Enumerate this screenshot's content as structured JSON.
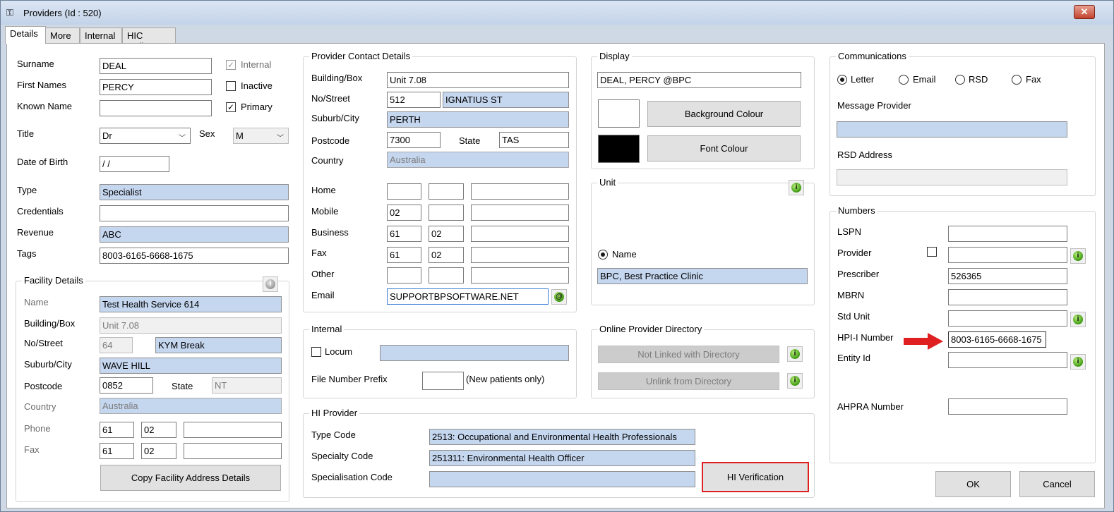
{
  "window": {
    "title": "Providers (Id : 520)",
    "close_glyph": "✕",
    "icon": "key-icon"
  },
  "tabs": [
    "Details",
    "More",
    "Internal",
    "HIC Online"
  ],
  "colors": {
    "field_blue": "#c5d6ef",
    "highlight_red": "#e02020",
    "accent_green": "#3f9a12"
  },
  "personal": {
    "surname_label": "Surname",
    "surname": "DEAL",
    "first_names_label": "First Names",
    "first_names": "PERCY",
    "known_name_label": "Known Name",
    "known_name": "",
    "title_label": "Title",
    "title": "Dr",
    "sex_label": "Sex",
    "sex": "M",
    "dob_label": "Date of Birth",
    "dob": " / /",
    "type_label": "Type",
    "type": "Specialist",
    "credentials_label": "Credentials",
    "credentials": "",
    "revenue_label": "Revenue",
    "revenue": "ABC",
    "tags_label": "Tags",
    "tags": "8003-6165-6668-1675",
    "internal_label": "Internal",
    "inactive_label": "Inactive",
    "primary_label": "Primary",
    "internal_checked": true,
    "inactive_checked": false,
    "primary_checked": true,
    "check_glyph": "✓"
  },
  "facility": {
    "group_title": "Facility Details",
    "name_label": "Name",
    "name": "Test Health Service 614",
    "building_label": "Building/Box",
    "building": "Unit 7.08",
    "street_label": "No/Street",
    "street_no": "64",
    "street_name": "KYM Break",
    "suburb_label": "Suburb/City",
    "suburb": "WAVE HILL",
    "postcode_label": "Postcode",
    "postcode": "0852",
    "state_label": "State",
    "state": "NT",
    "country_label": "Country",
    "country": "Australia",
    "phone_label": "Phone",
    "phone": [
      "61",
      "02",
      ""
    ],
    "fax_label": "Fax",
    "fax": [
      "61",
      "02",
      ""
    ],
    "copy_button": "Copy Facility Address Details"
  },
  "contact": {
    "group_title": "Provider Contact Details",
    "building_label": "Building/Box",
    "building": "Unit 7.08",
    "street_label": "No/Street",
    "street_no": "512",
    "street_name": "IGNATIUS ST",
    "suburb_label": "Suburb/City",
    "suburb": "PERTH",
    "postcode_label": "Postcode",
    "postcode": "7300",
    "state_label": "State",
    "state": "TAS",
    "country_label": "Country",
    "country": "Australia",
    "home_label": "Home",
    "home": [
      "",
      "",
      ""
    ],
    "mobile_label": "Mobile",
    "mobile": [
      "02",
      "",
      ""
    ],
    "business_label": "Business",
    "business": [
      "61",
      "02",
      ""
    ],
    "fax_label": "Fax",
    "fax": [
      "61",
      "02",
      ""
    ],
    "other_label": "Other",
    "other": [
      "",
      "",
      ""
    ],
    "email_label": "Email",
    "email": "SUPPORTBPSOFTWARE.NET",
    "email_glyph": "@"
  },
  "internal": {
    "group_title": "Internal",
    "locum_label": "Locum",
    "locum_value": "",
    "file_prefix_label": "File Number Prefix",
    "file_prefix": "",
    "file_prefix_note": "(New patients only)"
  },
  "hi_provider": {
    "group_title": "HI Provider",
    "type_code_label": "Type Code",
    "type_code": "2513: Occupational and Environmental Health Professionals",
    "specialty_code_label": "Specialty Code",
    "specialty_code": "251311: Environmental Health Officer",
    "specialisation_code_label": "Specialisation Code",
    "specialisation_code": "",
    "verify_button": "HI Verification"
  },
  "display": {
    "group_title": "Display",
    "display_name": "DEAL, PERCY @BPC",
    "background_button": "Background Colour",
    "font_button": "Font Colour",
    "background_color": "#ffffff",
    "font_color": "#000000"
  },
  "unit": {
    "group_title": "Unit",
    "name_radio": "Name",
    "unit_name": "BPC, Best Practice Clinic",
    "info_glyph": "i"
  },
  "directory": {
    "group_title": "Online Provider Directory",
    "link_button": "Not Linked with Directory",
    "unlink_button": "Unlink from Directory"
  },
  "communications": {
    "group_title": "Communications",
    "options": [
      "Letter",
      "Email",
      "RSD",
      "Fax"
    ],
    "selected": "Letter",
    "message_provider_label": "Message Provider",
    "message_provider": "",
    "rsd_address_label": "RSD Address",
    "rsd_address": ""
  },
  "numbers": {
    "group_title": "Numbers",
    "lspn_label": "LSPN",
    "lspn": "",
    "provider_label": "Provider",
    "provider": "",
    "prescriber_label": "Prescriber",
    "prescriber": "526365",
    "mbrn_label": "MBRN",
    "mbrn": "",
    "std_unit_label": "Std Unit",
    "std_unit": "",
    "hpii_label": "HPI-I Number",
    "hpii": "8003-6165-6668-1675",
    "entity_label": "Entity Id",
    "entity": "",
    "ahpra_label": "AHPRA Number",
    "ahpra": ""
  },
  "footer": {
    "ok_button": "OK",
    "cancel_button": "Cancel"
  }
}
